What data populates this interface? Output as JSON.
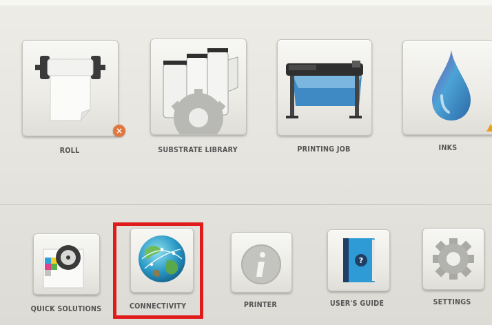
{
  "tiles": {
    "roll": {
      "label": "ROLL",
      "icon": "roll-icon",
      "badge": "×",
      "badge_color": "#e0773f"
    },
    "substrate_library": {
      "label": "SUBSTRATE LIBRARY",
      "icon": "substrate-library-icon"
    },
    "printing_job": {
      "label": "PRINTING JOB",
      "icon": "printer-icon"
    },
    "inks": {
      "label": "INKS",
      "icon": "ink-drop-icon",
      "warning_color": "#e6a11c"
    },
    "quick_solutions": {
      "label": "QUICK SOLUTIONS",
      "icon": "quick-solutions-icon"
    },
    "connectivity": {
      "label": "CONNECTIVITY",
      "icon": "globe-icon",
      "highlight_color": "#e01b1b"
    },
    "printer": {
      "label": "PRINTER",
      "icon": "info-icon"
    },
    "users_guide": {
      "label": "USER'S GUIDE",
      "icon": "guide-book-icon"
    },
    "settings": {
      "label": "SETTINGS",
      "icon": "gear-icon"
    }
  }
}
